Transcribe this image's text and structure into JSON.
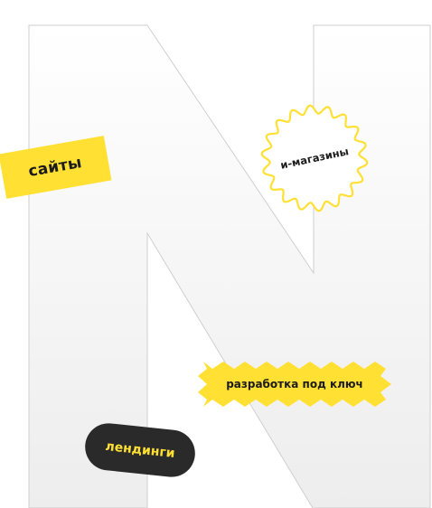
{
  "colors": {
    "accent_yellow": "#ffe033",
    "dark": "#2a2a2a",
    "text_dark": "#1c1c1c",
    "letter_outline": "#cfcfcf"
  },
  "decor": {
    "letter_n": "N"
  },
  "tags": {
    "sites": "сайты",
    "shops": "и-магазины",
    "turnkey": "разработка под ключ",
    "landings": "лендинги"
  }
}
